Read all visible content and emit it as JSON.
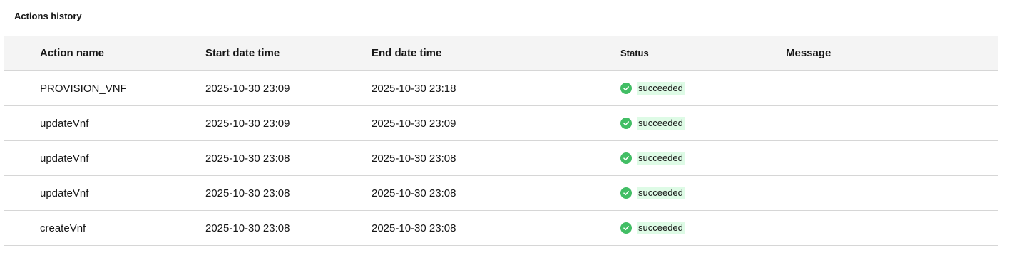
{
  "page": {
    "title": "Actions history"
  },
  "table": {
    "headers": {
      "action_name": "Action name",
      "start": "Start date time",
      "end": "End date time",
      "status": "Status",
      "message": "Message"
    },
    "rows": [
      {
        "action": "PROVISION_VNF",
        "start": "2025-10-30 23:09",
        "end": "2025-10-30 23:18",
        "status": "succeeded",
        "message": ""
      },
      {
        "action": "updateVnf",
        "start": "2025-10-30 23:09",
        "end": "2025-10-30 23:09",
        "status": "succeeded",
        "message": ""
      },
      {
        "action": "updateVnf",
        "start": "2025-10-30 23:08",
        "end": "2025-10-30 23:08",
        "status": "succeeded",
        "message": ""
      },
      {
        "action": "updateVnf",
        "start": "2025-10-30 23:08",
        "end": "2025-10-30 23:08",
        "status": "succeeded",
        "message": ""
      },
      {
        "action": "createVnf",
        "start": "2025-10-30 23:08",
        "end": "2025-10-30 23:08",
        "status": "succeeded",
        "message": ""
      }
    ]
  },
  "colors": {
    "success": "#42be65",
    "success_bg": "#defbe6",
    "header_bg": "#f4f4f4"
  },
  "icons": {
    "status": "checkmark-filled-icon"
  }
}
